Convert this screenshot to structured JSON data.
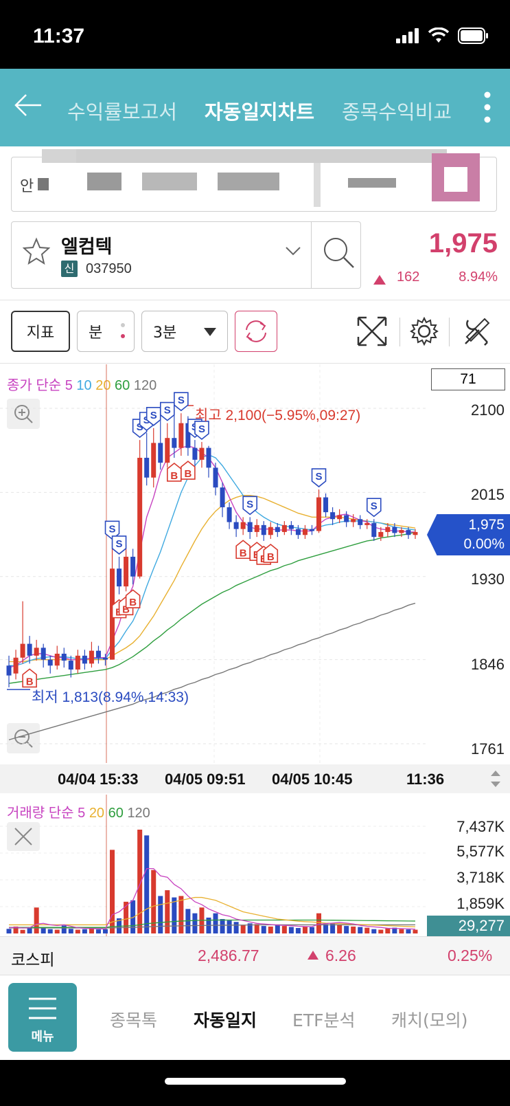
{
  "status": {
    "time": "11:37"
  },
  "header": {
    "tabs": [
      {
        "label": "수익률보고서",
        "active": false
      },
      {
        "label": "자동일지차트",
        "active": true
      },
      {
        "label": "종목수익비교",
        "active": false
      }
    ]
  },
  "account": {
    "prefix": "안"
  },
  "stock": {
    "name": "엘컴텍",
    "badge": "신",
    "code": "037950",
    "price": "1,975",
    "change": "162",
    "change_pct": "8.94%",
    "change_direction": "up"
  },
  "toolbar": {
    "indicator_label": "지표",
    "unit_label": "분",
    "interval_value": "3분"
  },
  "chart": {
    "legend_prefix": "종가 단순",
    "ma_periods": [
      "5",
      "10",
      "20",
      "60",
      "120"
    ],
    "ma_colors": [
      "#c742c0",
      "#3fa9e0",
      "#e8b030",
      "#2e9e3e",
      "#777777"
    ],
    "count_box": "71",
    "high_annotation": "최고 2,100(−5.95%,09:27)",
    "low_annotation": "최저 1,813(8.94%,14:33)",
    "current_price": "1,975",
    "current_pct": "0.00%",
    "times": [
      "04/04 15:33",
      "04/05 09:51",
      "04/05 10:45",
      "11:36"
    ]
  },
  "chart_data": [
    {
      "type": "candlestick",
      "yticks": [
        2100,
        2015,
        1930,
        1846,
        1761
      ],
      "ylim": [
        1761,
        2100
      ],
      "high": 2100,
      "low": 1813,
      "last": 1975,
      "candles": [
        {
          "o": 1840,
          "c": 1830,
          "h": 1850,
          "l": 1818
        },
        {
          "o": 1832,
          "c": 1848,
          "h": 1856,
          "l": 1826
        },
        {
          "o": 1848,
          "c": 1862,
          "h": 1905,
          "l": 1842
        },
        {
          "o": 1862,
          "c": 1850,
          "h": 1870,
          "l": 1842
        },
        {
          "o": 1850,
          "c": 1858,
          "h": 1866,
          "l": 1845
        },
        {
          "o": 1858,
          "c": 1846,
          "h": 1862,
          "l": 1838
        },
        {
          "o": 1846,
          "c": 1840,
          "h": 1850,
          "l": 1832
        },
        {
          "o": 1840,
          "c": 1852,
          "h": 1860,
          "l": 1836
        },
        {
          "o": 1852,
          "c": 1845,
          "h": 1858,
          "l": 1838
        },
        {
          "o": 1845,
          "c": 1836,
          "h": 1850,
          "l": 1828
        },
        {
          "o": 1836,
          "c": 1850,
          "h": 1856,
          "l": 1832
        },
        {
          "o": 1850,
          "c": 1842,
          "h": 1856,
          "l": 1836
        },
        {
          "o": 1842,
          "c": 1855,
          "h": 1864,
          "l": 1838
        },
        {
          "o": 1855,
          "c": 1848,
          "h": 1860,
          "l": 1842
        },
        {
          "o": 1848,
          "c": 1846,
          "h": 1852,
          "l": 1840
        },
        {
          "o": 1846,
          "c": 1938,
          "h": 1965,
          "l": 1846
        },
        {
          "o": 1938,
          "c": 1920,
          "h": 1950,
          "l": 1912
        },
        {
          "o": 1920,
          "c": 1950,
          "h": 1962,
          "l": 1915
        },
        {
          "o": 1950,
          "c": 1930,
          "h": 1958,
          "l": 1922
        },
        {
          "o": 1930,
          "c": 2050,
          "h": 2068,
          "l": 1928
        },
        {
          "o": 2050,
          "c": 2030,
          "h": 2075,
          "l": 2022
        },
        {
          "o": 2030,
          "c": 2065,
          "h": 2080,
          "l": 2020
        },
        {
          "o": 2065,
          "c": 2045,
          "h": 2090,
          "l": 2038
        },
        {
          "o": 2045,
          "c": 2070,
          "h": 2085,
          "l": 2040
        },
        {
          "o": 2070,
          "c": 2060,
          "h": 2100,
          "l": 2050
        },
        {
          "o": 2060,
          "c": 2085,
          "h": 2095,
          "l": 2052
        },
        {
          "o": 2085,
          "c": 2060,
          "h": 2092,
          "l": 2052
        },
        {
          "o": 2060,
          "c": 2048,
          "h": 2068,
          "l": 2040
        },
        {
          "o": 2048,
          "c": 2060,
          "h": 2066,
          "l": 2040
        },
        {
          "o": 2060,
          "c": 2040,
          "h": 2062,
          "l": 2030
        },
        {
          "o": 2040,
          "c": 2020,
          "h": 2045,
          "l": 2012
        },
        {
          "o": 2020,
          "c": 2000,
          "h": 2025,
          "l": 1990
        },
        {
          "o": 2000,
          "c": 1985,
          "h": 2005,
          "l": 1978
        },
        {
          "o": 1985,
          "c": 1978,
          "h": 1992,
          "l": 1970
        },
        {
          "o": 1978,
          "c": 1985,
          "h": 1990,
          "l": 1972
        },
        {
          "o": 1985,
          "c": 1975,
          "h": 1990,
          "l": 1968
        },
        {
          "o": 1975,
          "c": 1982,
          "h": 1988,
          "l": 1970
        },
        {
          "o": 1982,
          "c": 1972,
          "h": 1986,
          "l": 1966
        },
        {
          "o": 1972,
          "c": 1980,
          "h": 1985,
          "l": 1968
        },
        {
          "o": 1980,
          "c": 1975,
          "h": 1984,
          "l": 1970
        },
        {
          "o": 1975,
          "c": 1982,
          "h": 1986,
          "l": 1972
        },
        {
          "o": 1982,
          "c": 1978,
          "h": 1986,
          "l": 1972
        },
        {
          "o": 1978,
          "c": 1972,
          "h": 1982,
          "l": 1968
        },
        {
          "o": 1972,
          "c": 1978,
          "h": 1982,
          "l": 1968
        },
        {
          "o": 1978,
          "c": 1976,
          "h": 1982,
          "l": 1972
        },
        {
          "o": 1976,
          "c": 2010,
          "h": 2018,
          "l": 1974
        },
        {
          "o": 2010,
          "c": 1995,
          "h": 2014,
          "l": 1990
        },
        {
          "o": 1995,
          "c": 1988,
          "h": 2000,
          "l": 1982
        },
        {
          "o": 1988,
          "c": 1992,
          "h": 1998,
          "l": 1984
        },
        {
          "o": 1992,
          "c": 1985,
          "h": 1996,
          "l": 1980
        },
        {
          "o": 1985,
          "c": 1988,
          "h": 1993,
          "l": 1980
        },
        {
          "o": 1988,
          "c": 1982,
          "h": 1992,
          "l": 1978
        },
        {
          "o": 1982,
          "c": 1984,
          "h": 1988,
          "l": 1978
        },
        {
          "o": 1984,
          "c": 1970,
          "h": 1988,
          "l": 1966
        },
        {
          "o": 1970,
          "c": 1975,
          "h": 1980,
          "l": 1966
        },
        {
          "o": 1975,
          "c": 1980,
          "h": 1984,
          "l": 1970
        },
        {
          "o": 1980,
          "c": 1974,
          "h": 1984,
          "l": 1970
        },
        {
          "o": 1974,
          "c": 1977,
          "h": 1980,
          "l": 1970
        },
        {
          "o": 1977,
          "c": 1972,
          "h": 1980,
          "l": 1968
        },
        {
          "o": 1972,
          "c": 1975,
          "h": 1978,
          "l": 1968
        }
      ],
      "ma": {
        "5": [
          1838,
          1840,
          1845,
          1850,
          1852,
          1852,
          1850,
          1848,
          1848,
          1846,
          1846,
          1846,
          1848,
          1848,
          1848,
          1865,
          1882,
          1905,
          1920,
          1955,
          1990,
          2010,
          2035,
          2050,
          2055,
          2060,
          2062,
          2060,
          2055,
          2050,
          2040,
          2025,
          2010,
          1995,
          1985,
          1980,
          1978,
          1978,
          1978,
          1977,
          1977,
          1977,
          1976,
          1976,
          1976,
          1983,
          1988,
          1990,
          1992,
          1993,
          1990,
          1987,
          1985,
          1980,
          1978,
          1977,
          1976,
          1976,
          1975,
          1975
        ],
        "10": [
          1840,
          1840,
          1842,
          1845,
          1847,
          1848,
          1849,
          1849,
          1849,
          1848,
          1847,
          1847,
          1847,
          1847,
          1847,
          1856,
          1864,
          1875,
          1885,
          1900,
          1920,
          1938,
          1955,
          1975,
          1995,
          2015,
          2030,
          2042,
          2050,
          2053,
          2050,
          2042,
          2032,
          2022,
          2012,
          2002,
          1995,
          1990,
          1986,
          1983,
          1981,
          1980,
          1979,
          1978,
          1977,
          1980,
          1982,
          1983,
          1985,
          1986,
          1986,
          1986,
          1986,
          1985,
          1984,
          1982,
          1980,
          1979,
          1978,
          1977
        ],
        "20": [
          1844,
          1844,
          1844,
          1845,
          1846,
          1846,
          1846,
          1846,
          1846,
          1846,
          1846,
          1846,
          1846,
          1846,
          1846,
          1850,
          1854,
          1858,
          1863,
          1870,
          1880,
          1890,
          1902,
          1914,
          1926,
          1940,
          1953,
          1966,
          1978,
          1988,
          1996,
          2002,
          2007,
          2010,
          2012,
          2012,
          2011,
          2009,
          2006,
          2003,
          2000,
          1997,
          1994,
          1992,
          1990,
          1990,
          1990,
          1990,
          1990,
          1989,
          1988,
          1987,
          1986,
          1985,
          1984,
          1983,
          1982,
          1981,
          1980,
          1979
        ],
        "60": [
          1822,
          1823,
          1824,
          1825,
          1826,
          1827,
          1828,
          1829,
          1830,
          1831,
          1832,
          1833,
          1834,
          1835,
          1836,
          1838,
          1841,
          1845,
          1849,
          1854,
          1859,
          1865,
          1870,
          1876,
          1881,
          1887,
          1892,
          1897,
          1902,
          1906,
          1910,
          1914,
          1917,
          1921,
          1924,
          1927,
          1930,
          1933,
          1936,
          1938,
          1941,
          1943,
          1946,
          1948,
          1950,
          1952,
          1954,
          1956,
          1958,
          1960,
          1962,
          1964,
          1966,
          1967,
          1969,
          1970,
          1971,
          1972,
          1973,
          1975
        ],
        "120": [
          1765,
          1767,
          1769,
          1771,
          1773,
          1775,
          1777,
          1779,
          1781,
          1783,
          1785,
          1787,
          1789,
          1791,
          1793,
          1795,
          1797,
          1799,
          1801,
          1804,
          1806,
          1808,
          1811,
          1813,
          1816,
          1818,
          1821,
          1823,
          1826,
          1828,
          1831,
          1833,
          1836,
          1838,
          1841,
          1843,
          1846,
          1848,
          1851,
          1853,
          1856,
          1858,
          1861,
          1863,
          1866,
          1868,
          1871,
          1873,
          1876,
          1878,
          1881,
          1883,
          1886,
          1888,
          1891,
          1893,
          1896,
          1898,
          1901,
          1903
        ]
      },
      "signals": [
        {
          "i": 3,
          "type": "B"
        },
        {
          "i": 15,
          "type": "S"
        },
        {
          "i": 16,
          "type": "S"
        },
        {
          "i": 16,
          "type": "B"
        },
        {
          "i": 17,
          "type": "B"
        },
        {
          "i": 18,
          "type": "B"
        },
        {
          "i": 19,
          "type": "S"
        },
        {
          "i": 20,
          "type": "S"
        },
        {
          "i": 21,
          "type": "S"
        },
        {
          "i": 23,
          "type": "S"
        },
        {
          "i": 24,
          "type": "B"
        },
        {
          "i": 25,
          "type": "S"
        },
        {
          "i": 26,
          "type": "B"
        },
        {
          "i": 27,
          "type": "S"
        },
        {
          "i": 28,
          "type": "S"
        },
        {
          "i": 34,
          "type": "B"
        },
        {
          "i": 35,
          "type": "S"
        },
        {
          "i": 36,
          "type": "B"
        },
        {
          "i": 37,
          "type": "B"
        },
        {
          "i": 38,
          "type": "B"
        },
        {
          "i": 45,
          "type": "S"
        },
        {
          "i": 53,
          "type": "S"
        }
      ]
    },
    {
      "type": "bar",
      "legend_prefix": "거래량 단순",
      "ma_periods": [
        "5",
        "20",
        "60",
        "120"
      ],
      "ma_colors": [
        "#c742c0",
        "#e8b030",
        "#2e9e3e",
        "#777777"
      ],
      "yticks": [
        "7,437K",
        "5,577K",
        "3,718K",
        "1,859K"
      ],
      "ylim": [
        0,
        7437
      ],
      "current_volume": "29,277",
      "volumes": [
        320,
        480,
        250,
        360,
        1800,
        380,
        300,
        260,
        550,
        320,
        260,
        300,
        380,
        280,
        300,
        5800,
        1050,
        2200,
        2300,
        7200,
        6800,
        4400,
        2600,
        3000,
        2500,
        2600,
        1700,
        1400,
        1800,
        1100,
        1400,
        1000,
        900,
        800,
        600,
        700,
        650,
        520,
        480,
        600,
        520,
        450,
        380,
        500,
        440,
        1400,
        650,
        700,
        600,
        520,
        480,
        450,
        400,
        300,
        260,
        350,
        400,
        300,
        280,
        260
      ],
      "vol_ma5": [
        400,
        420,
        380,
        400,
        650,
        700,
        600,
        550,
        600,
        500,
        400,
        360,
        340,
        320,
        310,
        1300,
        1500,
        1900,
        2300,
        3400,
        4500,
        4500,
        4000,
        3900,
        3400,
        3100,
        2600,
        2200,
        2000,
        1700,
        1500,
        1300,
        1200,
        1000,
        900,
        800,
        700,
        660,
        620,
        580,
        560,
        540,
        500,
        480,
        470,
        650,
        680,
        720,
        760,
        720,
        660,
        560,
        500,
        460,
        420,
        360,
        350,
        340,
        320,
        300
      ],
      "vol_ma20": [
        600,
        600,
        600,
        600,
        600,
        600,
        600,
        600,
        600,
        600,
        600,
        600,
        600,
        600,
        600,
        800,
        900,
        1000,
        1100,
        1400,
        1700,
        1900,
        2000,
        2100,
        2200,
        2300,
        2400,
        2500,
        2500,
        2400,
        2300,
        2100,
        1900,
        1700,
        1500,
        1400,
        1300,
        1200,
        1100,
        1000,
        950,
        900,
        850,
        820,
        800,
        760,
        720,
        700,
        680,
        660,
        640,
        620,
        600,
        580,
        560,
        540,
        520,
        500,
        480,
        460
      ],
      "vol_ma60": [
        420,
        420,
        420,
        420,
        420,
        420,
        420,
        420,
        420,
        420,
        420,
        420,
        420,
        420,
        420,
        480,
        500,
        520,
        540,
        600,
        680,
        720,
        760,
        800,
        830,
        860,
        880,
        900,
        910,
        920,
        930,
        930,
        930,
        930,
        930,
        930,
        930,
        930,
        930,
        930,
        930,
        930,
        930,
        930,
        930,
        930,
        925,
        920,
        915,
        910,
        905,
        900,
        895,
        890,
        885,
        880,
        875,
        870,
        865,
        860
      ],
      "vol_ma120": [
        380,
        380,
        380,
        380,
        380,
        380,
        380,
        380,
        380,
        380,
        380,
        380,
        380,
        380,
        380,
        390,
        400,
        410,
        420,
        440,
        460,
        480,
        500,
        510,
        520,
        530,
        540,
        550,
        555,
        560,
        565,
        570,
        575,
        580,
        585,
        590,
        595,
        600,
        600,
        600,
        600,
        600,
        600,
        600,
        600,
        600,
        600,
        600,
        600,
        600,
        600,
        600,
        600,
        600,
        600,
        600,
        600,
        600,
        600,
        600
      ]
    }
  ],
  "kospi": {
    "name": "코스피",
    "value": "2,486.77",
    "change": "6.26",
    "change_pct": "0.25%"
  },
  "bottom_nav": {
    "menu_label": "메뉴",
    "items": [
      {
        "label": "종목톡",
        "active": false
      },
      {
        "label": "자동일지",
        "active": true
      },
      {
        "label": "ETF분석",
        "active": false
      },
      {
        "label": "캐치(모의)",
        "active": false
      }
    ]
  },
  "colors": {
    "up": "#d83a2e",
    "down": "#2a4bc0",
    "accent": "#55b6c3",
    "price": "#d2406c"
  }
}
